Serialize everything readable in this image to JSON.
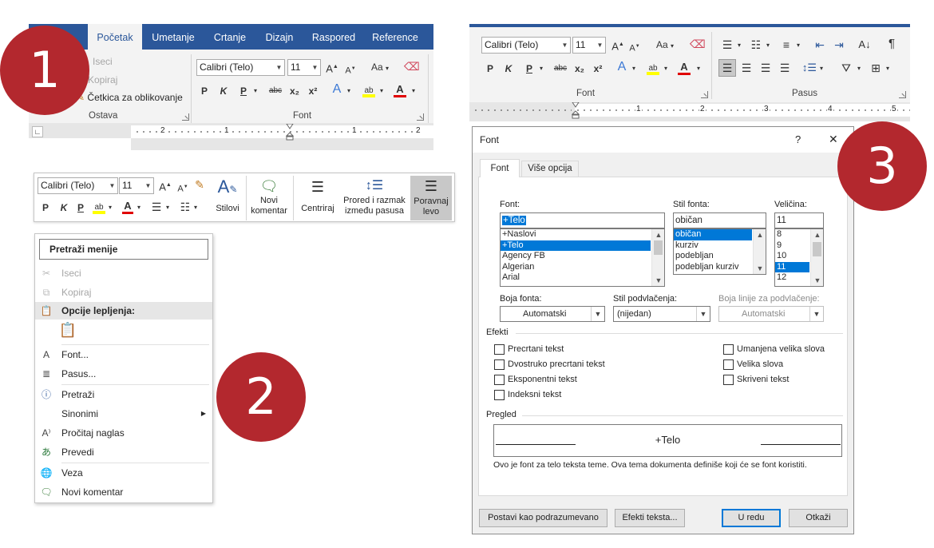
{
  "panel1": {
    "tabs": [
      "Početak",
      "Umetanje",
      "Crtanje",
      "Dizajn",
      "Raspored",
      "Reference"
    ],
    "clipboard": {
      "cut": "Iseci",
      "copy": "Kopiraj",
      "format_painter": "Četkica za oblikovanje",
      "group_label": "Ostava"
    },
    "font": {
      "name": "Calibri (Telo)",
      "size": "11",
      "bold": "P",
      "italic": "K",
      "underline": "P",
      "strike": "abc",
      "subscript": "x₂",
      "superscript": "x²",
      "change_case": "Aa",
      "group_label": "Font"
    },
    "ruler_numbers": [
      "2",
      "1",
      "1",
      "2"
    ]
  },
  "mini_toolbar": {
    "font_name": "Calibri (Telo)",
    "font_size": "11",
    "bold": "P",
    "italic": "K",
    "underline": "P",
    "styles_label": "Stilovi",
    "new_comment_label": "Novi komentar",
    "center_label": "Centriraj",
    "spacing_label": "Prored i razmak između pasusa",
    "align_left_label": "Poravnaj levo"
  },
  "context_menu": {
    "search_placeholder": "Pretraži menije",
    "items": {
      "cut": "Iseci",
      "copy": "Kopiraj",
      "paste_options": "Opcije lepljenja:",
      "font": "Font...",
      "paragraph": "Pasus...",
      "search": "Pretraži",
      "synonyms": "Sinonimi",
      "read_aloud": "Pročitaj naglas",
      "translate": "Prevedi",
      "link": "Veza",
      "new_comment": "Novi komentar"
    }
  },
  "markers": [
    "1",
    "2",
    "3"
  ],
  "panel3": {
    "font_name": "Calibri (Telo)",
    "font_size": "11",
    "bold": "P",
    "italic": "K",
    "underline": "P",
    "strike": "abc",
    "subscript": "x₂",
    "superscript": "x²",
    "change_case": "Aa",
    "font_group": "Font",
    "paragraph_group": "Pasus",
    "ruler_numbers": [
      "1",
      "2",
      "3",
      "4",
      "5"
    ]
  },
  "dialog": {
    "title": "Font",
    "help": "?",
    "close": "✕",
    "tabs": [
      "Font",
      "Više opcija"
    ],
    "font_label": "Font:",
    "font_value": "+Telo",
    "font_list": [
      "+Naslovi",
      "+Telo",
      "Agency FB",
      "Algerian",
      "Arial"
    ],
    "style_label": "Stil fonta:",
    "style_value": "običan",
    "style_list": [
      "običan",
      "kurziv",
      "podebljan",
      "podebljan kurziv"
    ],
    "size_label": "Veličina:",
    "size_value": "11",
    "size_list": [
      "8",
      "9",
      "10",
      "11",
      "12"
    ],
    "color_label": "Boja fonta:",
    "color_value": "Automatski",
    "underline_label": "Stil podvlačenja:",
    "underline_value": "(nijedan)",
    "underline_color_label": "Boja linije za podvlačenje:",
    "underline_color_value": "Automatski",
    "effects_label": "Efekti",
    "effects_left": [
      "Precrtani tekst",
      "Dvostruko precrtani tekst",
      "Eksponentni tekst",
      "Indeksni tekst"
    ],
    "effects_right": [
      "Umanjena velika slova",
      "Velika slova",
      "Skriveni tekst"
    ],
    "preview_label": "Pregled",
    "preview_text": "+Telo",
    "preview_desc": "Ovo je font za telo teksta teme. Ova tema dokumenta definiše koji će se font koristiti.",
    "btn_default": "Postavi kao podrazumevano",
    "btn_effects": "Efekti teksta...",
    "btn_ok": "U redu",
    "btn_cancel": "Otkaži"
  },
  "colors": {
    "word_blue": "#2b579a",
    "marker_red": "#b3282e",
    "highlight_yellow": "#ffff00",
    "font_red": "#e00000",
    "selection_blue": "#0078d7"
  }
}
